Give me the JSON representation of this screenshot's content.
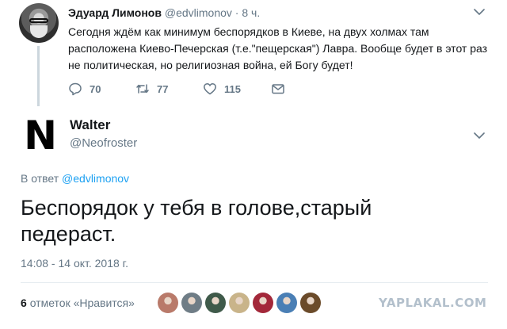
{
  "parent_tweet": {
    "author_name": "Эдуард Лимонов",
    "author_handle": "@edvlimonov",
    "separator": "·",
    "time": "8 ч.",
    "text": "Сегодня ждём как минимум беспорядков в Киеве, на двух холмах там расположена Киево-Печерская (т.е.\"пещерская\") Лавра. Вообще будет в этот раз не политическая, но религиозная война, ей Богу будет!",
    "replies_count": "70",
    "retweets_count": "77",
    "likes_count": "115",
    "icons": [
      "reply-icon",
      "retweet-icon",
      "like-icon",
      "message-icon",
      "chevron-down-icon"
    ]
  },
  "main_tweet": {
    "avatar_letter": "N",
    "author_name": "Walter",
    "author_handle": "@Neofroster",
    "reply_prefix": "В ответ",
    "reply_mention": "@edvlimonov",
    "text": "Беспорядок у тебя в голове,старый педераст.",
    "timestamp": "14:08 - 14 окт. 2018 г.",
    "likes_count": "6",
    "likes_label": "отметок «Нравится»",
    "likers": [
      {
        "color": "#b97a6a"
      },
      {
        "color": "#6f7d86"
      },
      {
        "color": "#3f5a4a"
      },
      {
        "color": "#c9b48a"
      },
      {
        "color": "#a3283a"
      },
      {
        "color": "#4a7fb5"
      },
      {
        "color": "#6b4b2a"
      }
    ]
  },
  "watermark": "YAPLAKAL.COM",
  "colors": {
    "text_primary": "#14171a",
    "text_secondary": "#657786",
    "link": "#1da1f2",
    "divider": "#e6ecf0",
    "thread_line": "#ccd6dd"
  }
}
